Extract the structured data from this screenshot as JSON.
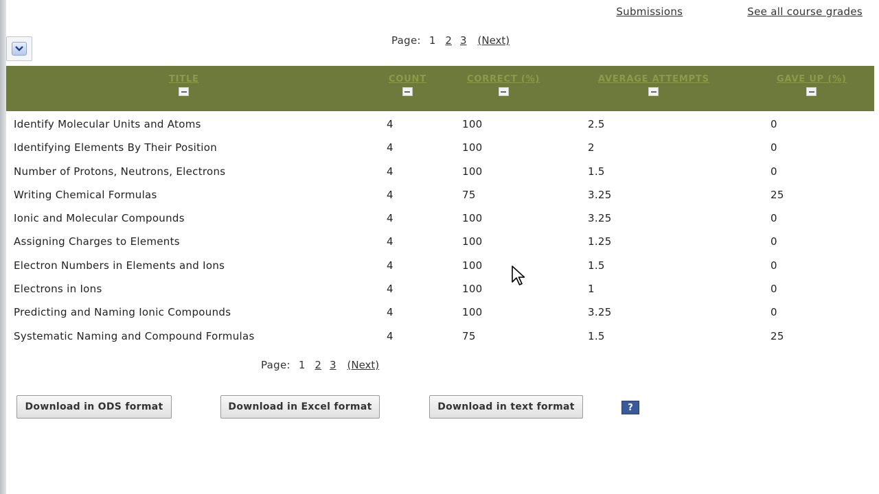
{
  "top_links": {
    "submissions": "Submissions",
    "see_all_grades": "See all course grades"
  },
  "pager": {
    "label": "Page:",
    "current": "1",
    "pages": [
      "2",
      "3"
    ],
    "next": "(Next)"
  },
  "table": {
    "columns": [
      "TITLE",
      "COUNT",
      "CORRECT (%)",
      "AVERAGE ATTEMPTS",
      "GAVE UP (%)"
    ],
    "rows": [
      [
        "Identify Molecular Units and Atoms",
        "4",
        "100",
        "2.5",
        "0"
      ],
      [
        "Identifying Elements By Their Position",
        "4",
        "100",
        "2",
        "0"
      ],
      [
        "Number of Protons, Neutrons, Electrons",
        "4",
        "100",
        "1.5",
        "0"
      ],
      [
        "Writing Chemical Formulas",
        "4",
        "75",
        "3.25",
        "25"
      ],
      [
        "Ionic and Molecular Compounds",
        "4",
        "100",
        "3.25",
        "0"
      ],
      [
        "Assigning Charges to Elements",
        "4",
        "100",
        "1.25",
        "0"
      ],
      [
        "Electron Numbers in Elements and Ions",
        "4",
        "100",
        "1.5",
        "0"
      ],
      [
        "Electrons in Ions",
        "4",
        "100",
        "1",
        "0"
      ],
      [
        "Predicting and Naming Ionic Compounds",
        "4",
        "100",
        "3.25",
        "0"
      ],
      [
        "Systematic Naming and Compound Formulas",
        "4",
        "75",
        "1.5",
        "25"
      ]
    ]
  },
  "buttons": {
    "ods": "Download in ODS format",
    "excel": "Download in Excel format",
    "text": "Download in text format"
  },
  "help": {
    "glyph": "?"
  },
  "colors": {
    "header_bg": "#6d7a3c",
    "header_text": "#8c9a4a",
    "help_bg": "#3a5a9a"
  }
}
